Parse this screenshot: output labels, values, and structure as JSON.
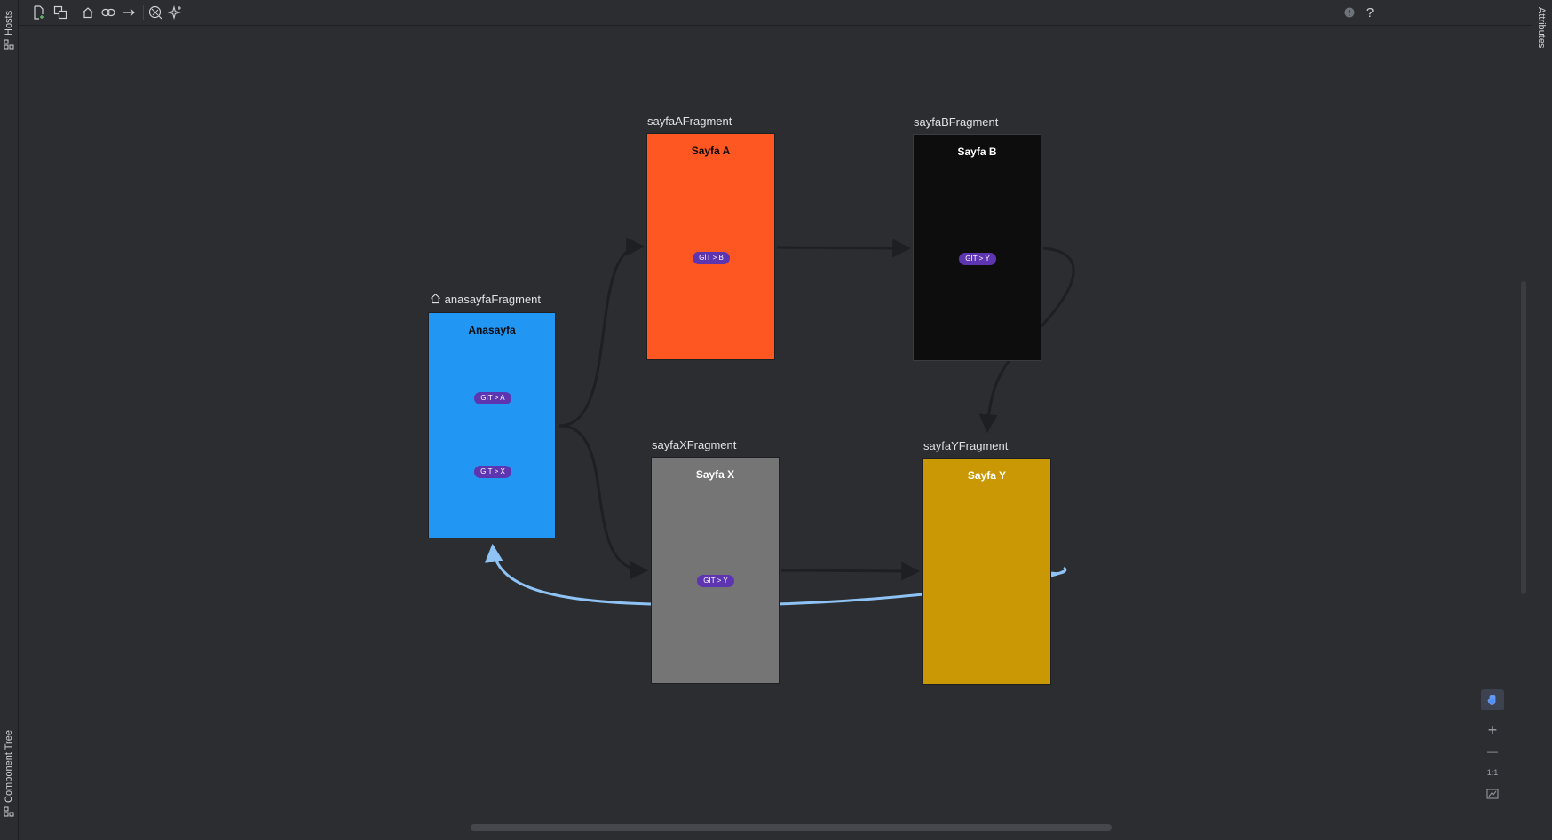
{
  "left_strip": {
    "hosts_label": "Hosts",
    "component_tree_label": "Component Tree"
  },
  "right_strip": {
    "attributes_label": "Attributes"
  },
  "toolbar": {
    "icons": [
      "new-destination-icon",
      "nested-graph-icon",
      "home-icon",
      "deep-link-icon",
      "action-arrow-icon",
      "auto-arrange-icon",
      "magic-sparkle-icon"
    ],
    "right_icons": [
      "warning-icon",
      "help-icon"
    ],
    "help_label": "?"
  },
  "colors": {
    "anasayfa": "#2196f3",
    "sayfa_a": "#ff5722",
    "sayfa_b": "#0d0d0d",
    "sayfa_x": "#757575",
    "sayfa_y": "#c99804",
    "pill": "#5e35b1",
    "action_arrow": "#1e1f22",
    "pop_arrow": "#8fc3f5"
  },
  "graph": {
    "start_destination": "anasayfaFragment",
    "fragments": [
      {
        "id": "anasayfaFragment",
        "title": "Anasayfa",
        "buttons": [
          "GİT > A",
          "GİT > X"
        ]
      },
      {
        "id": "sayfaAFragment",
        "title": "Sayfa A",
        "buttons": [
          "GİT > B"
        ]
      },
      {
        "id": "sayfaBFragment",
        "title": "Sayfa B",
        "buttons": [
          "GİT > Y"
        ]
      },
      {
        "id": "sayfaXFragment",
        "title": "Sayfa X",
        "buttons": [
          "GİT > Y"
        ]
      },
      {
        "id": "sayfaYFragment",
        "title": "Sayfa Y",
        "buttons": []
      }
    ],
    "actions": [
      {
        "from": "anasayfaFragment",
        "to": "sayfaAFragment"
      },
      {
        "from": "anasayfaFragment",
        "to": "sayfaXFragment"
      },
      {
        "from": "sayfaAFragment",
        "to": "sayfaBFragment"
      },
      {
        "from": "sayfaBFragment",
        "to": "sayfaYFragment"
      },
      {
        "from": "sayfaXFragment",
        "to": "sayfaYFragment"
      },
      {
        "from": "sayfaYFragment",
        "to": "anasayfaFragment",
        "type": "popUpTo"
      }
    ]
  },
  "zoom_controls": {
    "pan_icon": "hand-icon",
    "zoom_in": "+",
    "zoom_out": "—",
    "actual_size": "1:1",
    "fit_icon": "zoom-to-fit-icon"
  }
}
